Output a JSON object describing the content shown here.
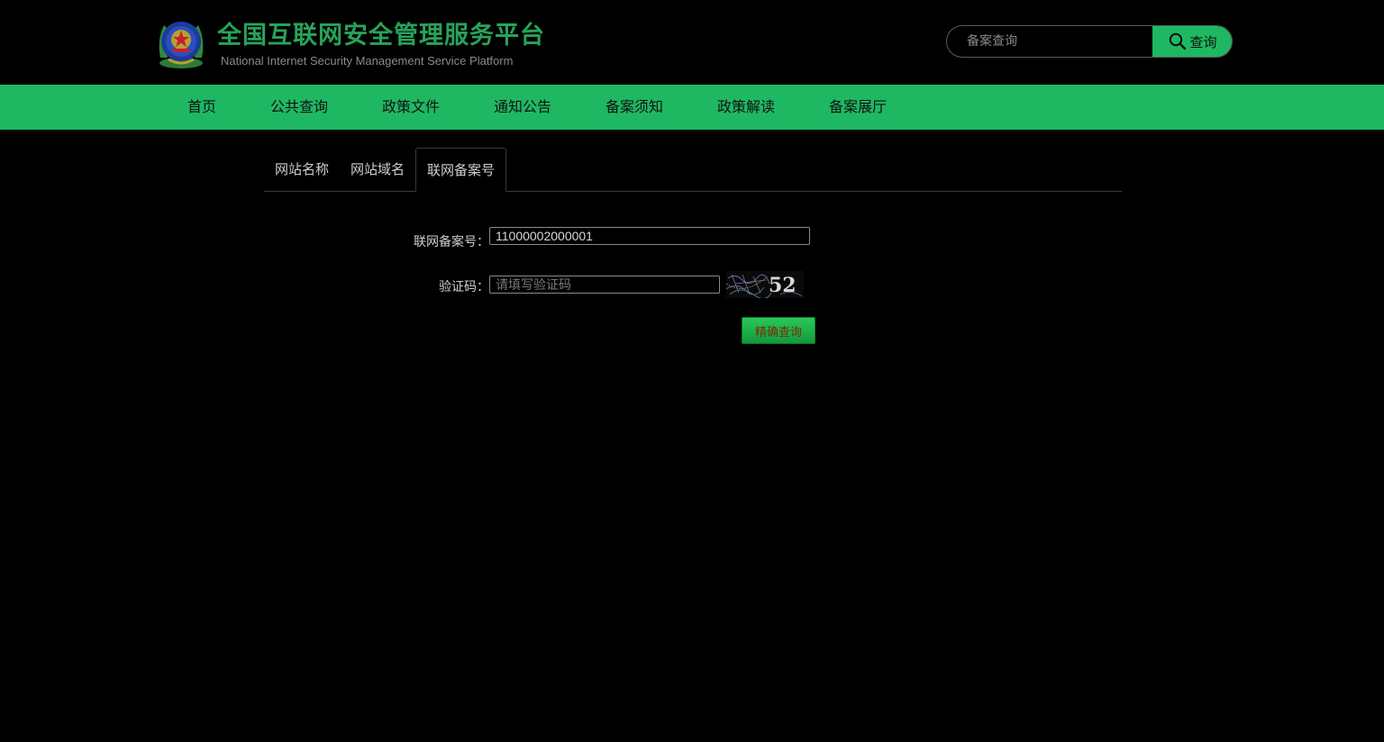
{
  "header": {
    "title": "全国互联网安全管理服务平台",
    "subtitle": "National Internet Security Management Service Platform",
    "emblem_icon": "police-emblem-icon",
    "search": {
      "placeholder": "备案查询",
      "button_label": "查询",
      "button_icon": "search-icon"
    }
  },
  "nav": {
    "items": [
      {
        "label": "首页"
      },
      {
        "label": "公共查询"
      },
      {
        "label": "政策文件"
      },
      {
        "label": "通知公告"
      },
      {
        "label": "备案须知"
      },
      {
        "label": "政策解读"
      },
      {
        "label": "备案展厅"
      }
    ]
  },
  "tabs": [
    {
      "label": "网站名称",
      "active": false
    },
    {
      "label": "网站域名",
      "active": false
    },
    {
      "label": "联网备案号",
      "active": true
    }
  ],
  "form": {
    "record_label": "联网备案号：",
    "record_value": "11000002000001",
    "captcha_label": "验证码：",
    "captcha_placeholder": "请填写验证码",
    "captcha_text": "52",
    "submit_label": "精确查询"
  },
  "colors": {
    "brand_green": "#1fb862",
    "title_green": "#27a35a",
    "background": "#000000"
  }
}
